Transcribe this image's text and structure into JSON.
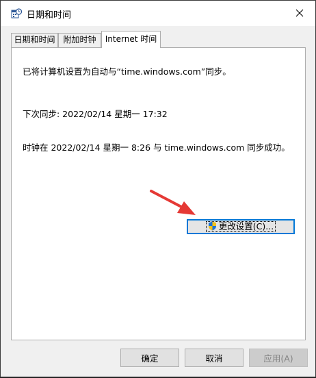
{
  "window": {
    "title": "日期和时间"
  },
  "tabs": [
    {
      "label": "日期和时间"
    },
    {
      "label": "附加时钟"
    },
    {
      "label": "Internet 时间"
    }
  ],
  "panel": {
    "line1": "已将计算机设置为自动与“time.windows.com”同步。",
    "line2": "下次同步: 2022/02/14 星期一 17:32",
    "line3": "时钟在 2022/02/14 星期一 8:26 与 time.windows.com 同步成功。",
    "change_button": "更改设置(C)..."
  },
  "footer": {
    "ok": "确定",
    "cancel": "取消",
    "apply": "应用(A)"
  },
  "colors": {
    "accent": "#0078d7",
    "arrow": "#e53935"
  }
}
